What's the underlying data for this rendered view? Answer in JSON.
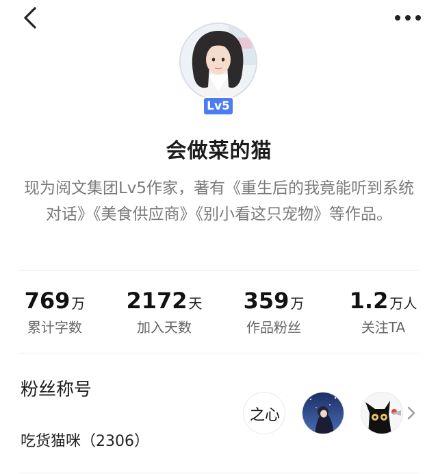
{
  "header": {
    "back_icon": "chevron-left-icon",
    "more_icon": "more-horizontal-icon"
  },
  "profile": {
    "level": "Lv5",
    "name": "会做菜的猫",
    "bio": "现为阅文集团Lv5作家，著有《重生后的我竟能听到系统对话》《美食供应商》《别小看这只宠物》等作品。"
  },
  "stats": [
    {
      "value": "769",
      "unit": "万",
      "label": "累计字数"
    },
    {
      "value": "2172",
      "unit": "天",
      "label": "加入天数"
    },
    {
      "value": "359",
      "unit": "万",
      "label": "作品粉丝"
    },
    {
      "value": "1.2",
      "unit": "万人",
      "label": "关注TA"
    }
  ],
  "fans": {
    "title": "粉丝称号",
    "value": "吃货猫咪（2306）",
    "avatar_1_text": "之心",
    "chevron_icon": "chevron-right-icon"
  },
  "colors": {
    "accent": "#4c7cf3",
    "text_primary": "#1c1c1c",
    "text_secondary": "#7a7a7a",
    "divider": "#ececec"
  }
}
